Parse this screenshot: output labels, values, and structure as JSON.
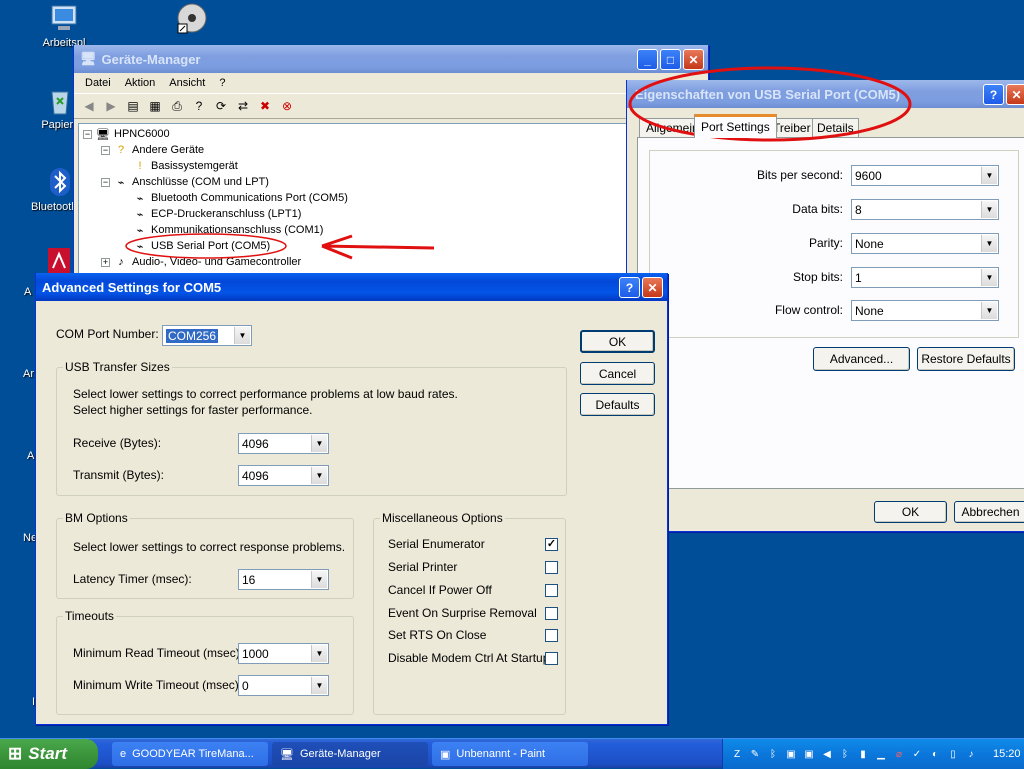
{
  "desktop": {
    "icons": [
      {
        "label": "Arbeitspl"
      },
      {
        "label": "Papierk"
      },
      {
        "label": "Bluetooth-U"
      }
    ],
    "stubs": [
      "A",
      "Ar",
      "A",
      "Ne",
      "I"
    ]
  },
  "device_manager": {
    "title": "Geräte-Manager",
    "menu": [
      "Datei",
      "Aktion",
      "Ansicht",
      "?"
    ],
    "tree": {
      "root": "HPNC6000",
      "nodes": [
        "Andere Geräte",
        "Basissystemgerät",
        "Anschlüsse (COM und LPT)",
        "Bluetooth Communications Port (COM5)",
        "ECP-Druckeranschluss (LPT1)",
        "Kommunikationsanschluss (COM1)",
        "USB Serial Port (COM5)",
        "Audio-, Video- und Gamecontroller"
      ]
    }
  },
  "properties": {
    "title": "Eigenschaften von USB Serial Port (COM5)",
    "tabs": [
      "Allgemein",
      "Port Settings",
      "Treiber",
      "Details"
    ],
    "fields": [
      {
        "label": "Bits per second:",
        "value": "9600"
      },
      {
        "label": "Data bits:",
        "value": "8"
      },
      {
        "label": "Parity:",
        "value": "None"
      },
      {
        "label": "Stop bits:",
        "value": "1"
      },
      {
        "label": "Flow control:",
        "value": "None"
      }
    ],
    "advanced_label": "Advanced...",
    "restore_label": "Restore Defaults",
    "ok_label": "OK",
    "cancel_label": "Abbrechen"
  },
  "advanced": {
    "title": "Advanced Settings for COM5",
    "com_port_label": "COM Port Number:",
    "com_port_value": "COM256",
    "usb_group": "USB Transfer Sizes",
    "usb_text1": "Select lower settings to correct performance problems at low baud rates.",
    "usb_text2": "Select higher settings for faster performance.",
    "receive_label": "Receive (Bytes):",
    "receive_value": "4096",
    "transmit_label": "Transmit (Bytes):",
    "transmit_value": "4096",
    "bm_group": "BM Options",
    "bm_text": "Select lower settings to correct response problems.",
    "latency_label": "Latency Timer (msec):",
    "latency_value": "16",
    "timeouts_group": "Timeouts",
    "read_timeout_label": "Minimum Read Timeout (msec):",
    "read_timeout_value": "1000",
    "write_timeout_label": "Minimum Write Timeout (msec):",
    "write_timeout_value": "0",
    "misc_group": "Miscellaneous Options",
    "misc_options": [
      {
        "label": "Serial Enumerator",
        "checked": true
      },
      {
        "label": "Serial Printer",
        "checked": false
      },
      {
        "label": "Cancel If Power Off",
        "checked": false
      },
      {
        "label": "Event On Surprise Removal",
        "checked": false
      },
      {
        "label": "Set RTS On Close",
        "checked": false
      },
      {
        "label": "Disable Modem Ctrl At Startup",
        "checked": false
      }
    ],
    "ok_label": "OK",
    "cancel_label": "Cancel",
    "defaults_label": "Defaults"
  },
  "taskbar": {
    "start_label": "Start",
    "tasks": [
      {
        "label": "GOODYEAR TireMana..."
      },
      {
        "label": "Geräte-Manager"
      },
      {
        "label": "Unbenannt - Paint"
      }
    ],
    "clock": "15:20"
  },
  "colors": {
    "desktop": "#004e98",
    "annotation": "#e01010"
  }
}
